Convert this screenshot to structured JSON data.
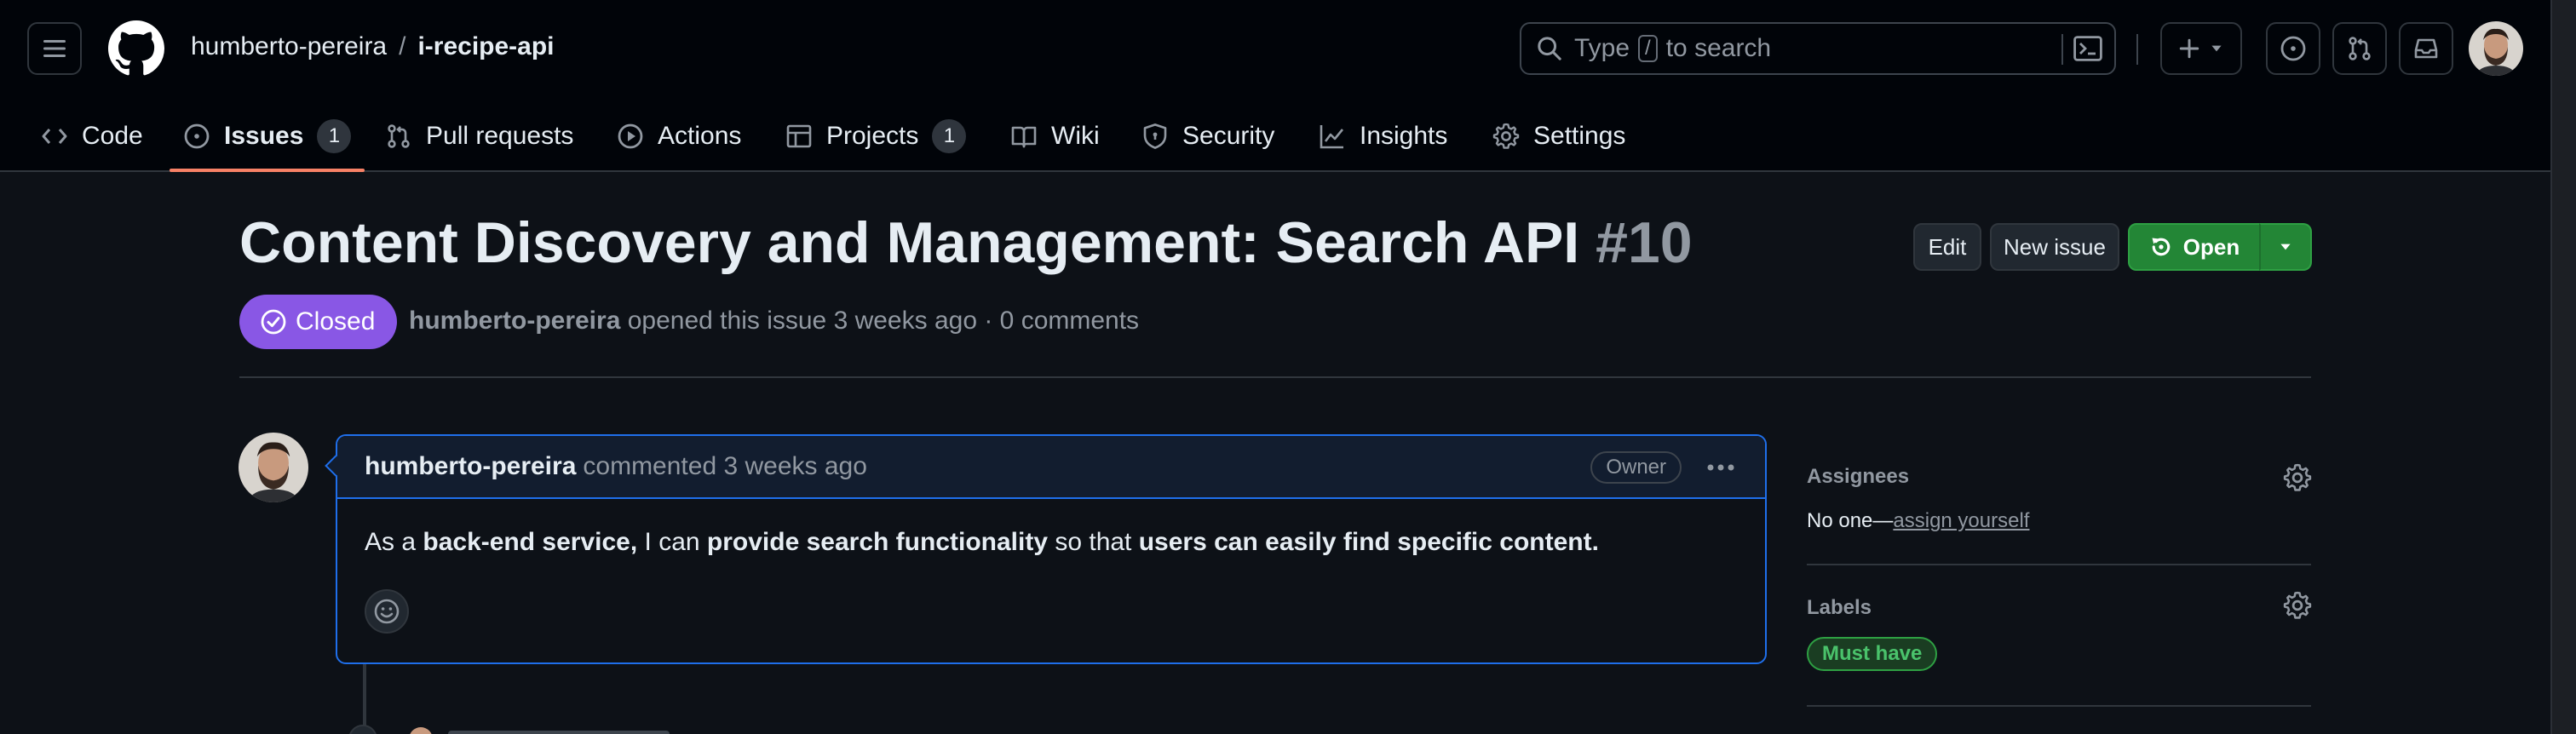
{
  "header": {
    "owner": "humberto-pereira",
    "separator": "/",
    "repo": "i-recipe-api",
    "search": {
      "prefix": "Type",
      "key": "/",
      "suffix": "to search"
    }
  },
  "nav": {
    "items": [
      {
        "label": "Code",
        "icon": "code-icon"
      },
      {
        "label": "Issues",
        "icon": "issue-opened-icon",
        "count": "1",
        "active": true
      },
      {
        "label": "Pull requests",
        "icon": "git-pull-request-icon"
      },
      {
        "label": "Actions",
        "icon": "play-icon"
      },
      {
        "label": "Projects",
        "icon": "table-icon",
        "count": "1"
      },
      {
        "label": "Wiki",
        "icon": "book-icon"
      },
      {
        "label": "Security",
        "icon": "shield-icon"
      },
      {
        "label": "Insights",
        "icon": "graph-icon"
      },
      {
        "label": "Settings",
        "icon": "gear-icon"
      }
    ]
  },
  "issue": {
    "title": "Content Discovery and Management: Search API",
    "number": "#10",
    "state": "Closed",
    "author": "humberto-pereira",
    "meta": "opened this issue 3 weeks ago · 0 comments",
    "actions": {
      "edit": "Edit",
      "new_issue": "New issue",
      "open": "Open"
    }
  },
  "comment": {
    "author": "humberto-pereira",
    "time": "commented 3 weeks ago",
    "role": "Owner",
    "body": [
      {
        "text": "As a ",
        "bold": false
      },
      {
        "text": "back-end service,",
        "bold": true
      },
      {
        "text": " I can ",
        "bold": false
      },
      {
        "text": "provide search functionality",
        "bold": true
      },
      {
        "text": " so that ",
        "bold": false
      },
      {
        "text": "users can easily find specific content.",
        "bold": true
      }
    ]
  },
  "sidebar": {
    "assignees": {
      "title": "Assignees",
      "value": "No one—",
      "link": "assign yourself"
    },
    "labels": {
      "title": "Labels",
      "items": [
        "Must have"
      ]
    }
  },
  "colors": {
    "accent_underline": "#f78166",
    "closed_badge": "#8957e5",
    "open_button": "#238636",
    "comment_border": "#1f6feb",
    "label_green": "#4ac26b"
  }
}
